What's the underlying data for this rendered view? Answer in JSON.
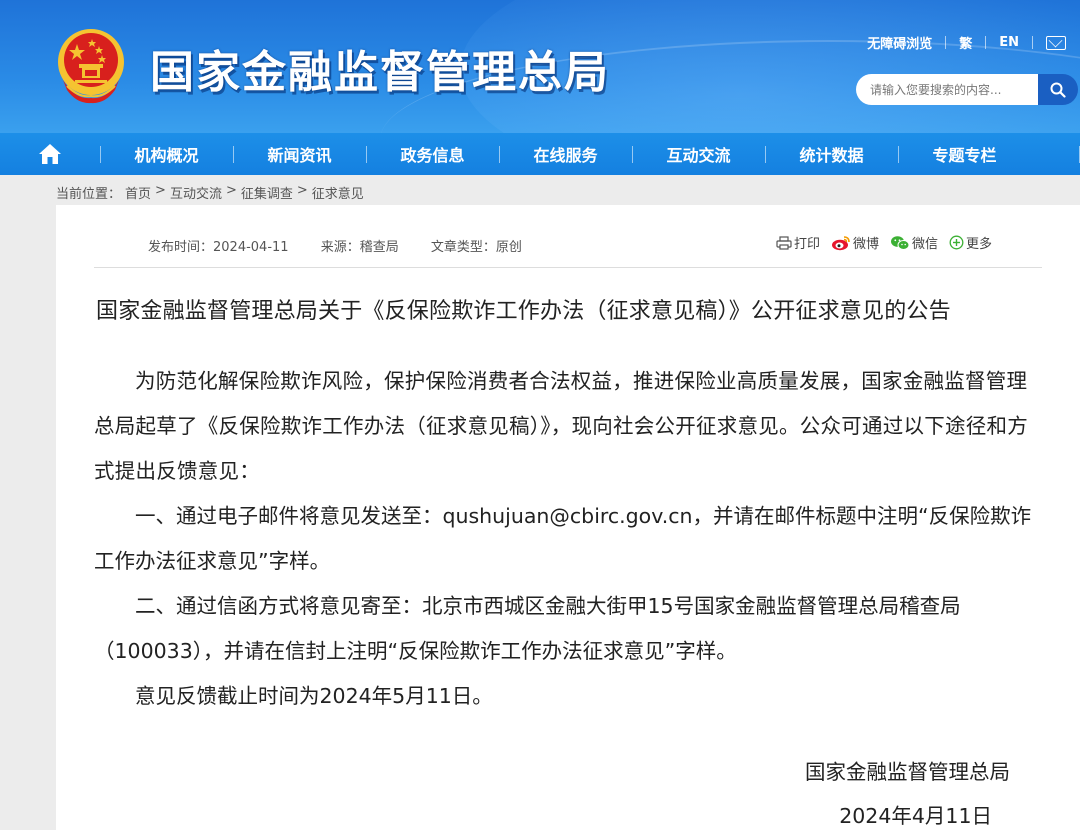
{
  "header": {
    "site_title": "国家金融监督管理总局",
    "top_links": [
      "无障碍浏览",
      "繁",
      "EN"
    ],
    "search_placeholder": "请输入您要搜索的内容..."
  },
  "nav": {
    "items": [
      "机构概况",
      "新闻资讯",
      "政务信息",
      "在线服务",
      "互动交流",
      "统计数据",
      "专题专栏"
    ]
  },
  "breadcrumb": {
    "prefix": "当前位置：",
    "items": [
      "首页",
      "互动交流",
      "征集调查",
      "征求意见"
    ],
    "separator": ">"
  },
  "meta": {
    "publish_time": "发布时间：2024-04-11",
    "source": "来源：稽查局",
    "type": "文章类型：原创"
  },
  "share": {
    "print": "打印",
    "weibo": "微博",
    "wechat": "微信",
    "more": "更多"
  },
  "article": {
    "title": "国家金融监督管理总局关于《反保险欺诈工作办法（征求意见稿）》公开征求意见的公告",
    "paragraphs": [
      "为防范化解保险欺诈风险，保护保险消费者合法权益，推进保险业高质量发展，国家金融监督管理总局起草了《反保险欺诈工作办法（征求意见稿）》，现向社会公开征求意见。公众可通过以下途径和方式提出反馈意见：",
      "一、通过电子邮件将意见发送至：qushujuan@cbirc.gov.cn，并请在邮件标题中注明“反保险欺诈工作办法征求意见”字样。",
      "二、通过信函方式将意见寄至：北京市西城区金融大街甲15号国家金融监督管理总局稽查局（100033），并请在信封上注明“反保险欺诈工作办法征求意见”字样。",
      "意见反馈截止时间为2024年5月11日。"
    ],
    "signature_org": "国家金融监督管理总局",
    "signature_date": "2024年4月11日"
  },
  "colors": {
    "header_blue": "#1f73d8",
    "nav_blue": "#1480e0",
    "search_button": "#1a5fc2",
    "emblem_red": "#d8201d",
    "emblem_gold": "#f5c331"
  }
}
